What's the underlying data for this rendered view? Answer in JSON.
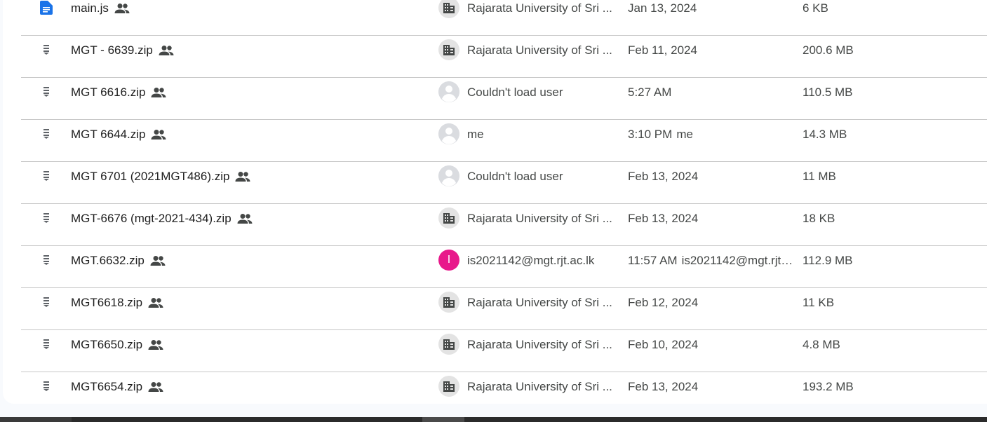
{
  "files": [
    {
      "name": "main.js",
      "type": "document",
      "owner": "Rajarata University of Sri ...",
      "owner_type": "org",
      "modified": "Jan 13, 2024",
      "modified_by": "",
      "size": "6 KB"
    },
    {
      "name": "MGT - 6639.zip",
      "type": "zip",
      "owner": "Rajarata University of Sri ...",
      "owner_type": "org",
      "modified": "Feb 11, 2024",
      "modified_by": "",
      "size": "200.6 MB"
    },
    {
      "name": "MGT 6616.zip",
      "type": "zip",
      "owner": "Couldn't load user",
      "owner_type": "user",
      "modified": "5:27 AM",
      "modified_by": "",
      "size": "110.5 MB"
    },
    {
      "name": "MGT 6644.zip",
      "type": "zip",
      "owner": "me",
      "owner_type": "user",
      "modified": "3:10 PM",
      "modified_by": "me",
      "size": "14.3 MB"
    },
    {
      "name": "MGT 6701 (2021MGT486).zip",
      "type": "zip",
      "owner": "Couldn't load user",
      "owner_type": "user",
      "modified": "Feb 13, 2024",
      "modified_by": "",
      "size": "11 MB"
    },
    {
      "name": "MGT-6676 (mgt-2021-434).zip",
      "type": "zip",
      "owner": "Rajarata University of Sri ...",
      "owner_type": "org",
      "modified": "Feb 13, 2024",
      "modified_by": "",
      "size": "18 KB"
    },
    {
      "name": "MGT.6632.zip",
      "type": "zip",
      "owner": "is2021142@mgt.rjt.ac.lk",
      "owner_type": "letter",
      "owner_initial": "I",
      "modified": "11:57 AM",
      "modified_by": "is2021142@mgt.rjt....",
      "size": "112.9 MB"
    },
    {
      "name": "MGT6618.zip",
      "type": "zip",
      "owner": "Rajarata University of Sri ...",
      "owner_type": "org",
      "modified": "Feb 12, 2024",
      "modified_by": "",
      "size": "11 KB"
    },
    {
      "name": "MGT6650.zip",
      "type": "zip",
      "owner": "Rajarata University of Sri ...",
      "owner_type": "org",
      "modified": "Feb 10, 2024",
      "modified_by": "",
      "size": "4.8 MB"
    },
    {
      "name": "MGT6654.zip",
      "type": "zip",
      "owner": "Rajarata University of Sri ...",
      "owner_type": "org",
      "modified": "Feb 13, 2024",
      "modified_by": "",
      "size": "193.2 MB"
    }
  ],
  "colors": {
    "doc_icon": "#1a73e8",
    "zip_icon": "#5f6368",
    "avatar_letter_bg": "#e8198b"
  }
}
